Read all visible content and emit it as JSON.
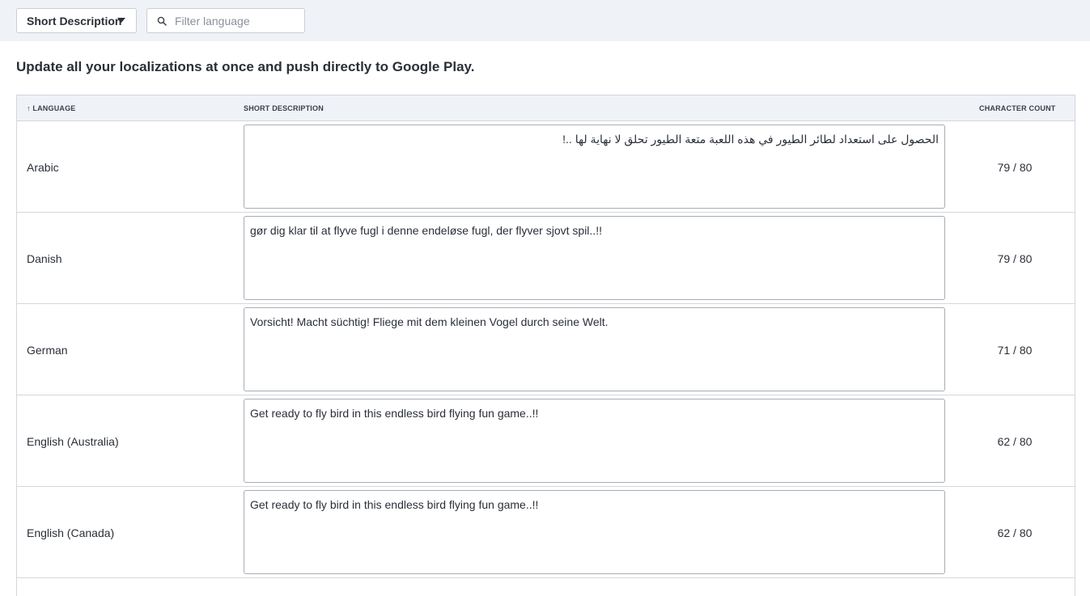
{
  "toolbar": {
    "field_select_label": "Short Description",
    "filter_placeholder": "Filter language"
  },
  "headline": "Update all your localizations at once and push directly to Google Play.",
  "table": {
    "headers": {
      "language": "↑ LANGUAGE",
      "description": "SHORT DESCRIPTION",
      "count": "CHARACTER COUNT"
    },
    "rows": [
      {
        "language": "Arabic",
        "description": "الحصول على استعداد لطائر الطيور في هذه اللعبة متعة الطيور تحلق لا نهاية لها ..!",
        "count": "79 / 80"
      },
      {
        "language": "Danish",
        "description": "gør dig klar til at flyve fugl i denne endeløse fugl, der flyver sjovt spil..!!",
        "count": "79 / 80"
      },
      {
        "language": "German",
        "description": "Vorsicht! Macht süchtig! Fliege mit dem kleinen Vogel durch seine Welt.",
        "count": "71 / 80"
      },
      {
        "language": "English (Australia)",
        "description": "Get ready to fly bird in this endless bird flying fun game..!!",
        "count": "62 / 80"
      },
      {
        "language": "English (Canada)",
        "description": "Get ready to fly bird in this endless bird flying fun game..!!",
        "count": "62 / 80"
      }
    ]
  }
}
